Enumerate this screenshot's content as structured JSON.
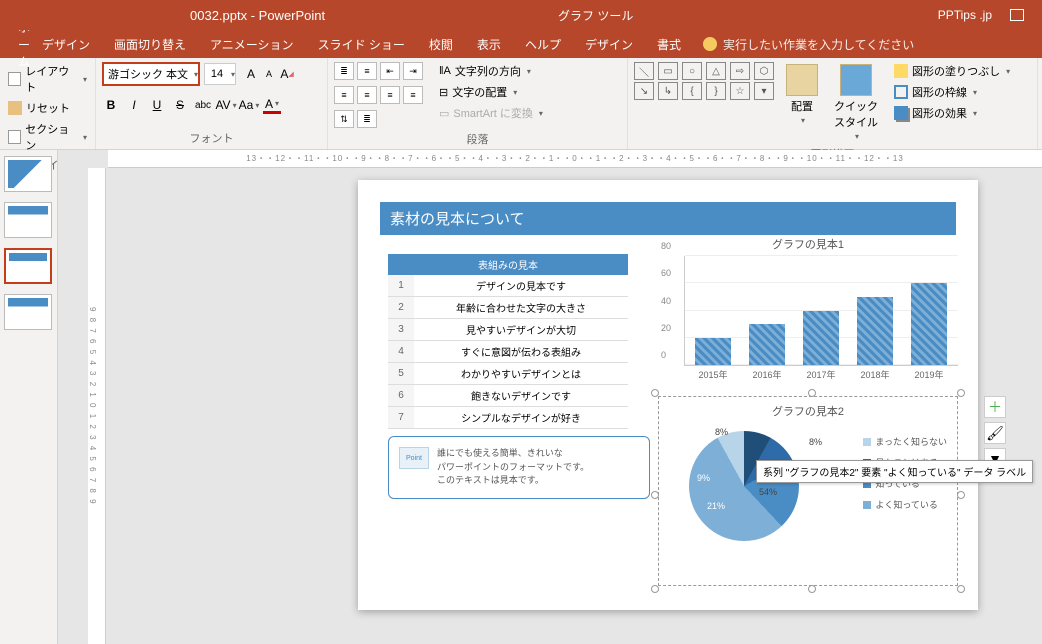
{
  "title": {
    "filename": "0032.pptx - PowerPoint",
    "context": "グラフ ツール",
    "brand": "PPTips .jp"
  },
  "tabs": [
    "ホーム",
    "デザイン",
    "画面切り替え",
    "アニメーション",
    "スライド ショー",
    "校閲",
    "表示",
    "ヘルプ",
    "デザイン",
    "書式"
  ],
  "tellme": "実行したい作業を入力してください",
  "ribbon": {
    "slides": {
      "layout": "レイアウト",
      "reset": "リセット",
      "section": "セクション",
      "label": "スライド"
    },
    "font": {
      "name": "游ゴシック 本文",
      "size": "14",
      "label": "フォント"
    },
    "para": {
      "label": "段落",
      "direction": "文字列の方向",
      "align": "文字の配置",
      "smartart": "SmartArt に変換"
    },
    "draw": {
      "label": "図形描画",
      "arrange": "配置",
      "quick": "クイック\nスタイル",
      "fill": "図形の塗りつぶし",
      "outline": "図形の枠線",
      "effects": "図形の効果"
    }
  },
  "ruler": "13・・12・・11・・10・・9・・8・・7・・6・・5・・4・・3・・2・・1・・0・・1・・2・・3・・4・・5・・6・・7・・8・・9・・10・・11・・12・・13",
  "rulerv": "9  8  7  6  5  4  3  2  1  0  1  2  3  4  5  6  7  8  9",
  "slide": {
    "title": "素材の見本について",
    "table": {
      "header": "表組みの見本",
      "rows": [
        [
          "1",
          "デザインの見本です"
        ],
        [
          "2",
          "年齢に合わせた文字の大きさ"
        ],
        [
          "3",
          "見やすいデザインが大切"
        ],
        [
          "4",
          "すぐに意図が伝わる表組み"
        ],
        [
          "5",
          "わかりやすいデザインとは"
        ],
        [
          "6",
          "飽きないデザインです"
        ],
        [
          "7",
          "シンプルなデザインが好き"
        ]
      ]
    },
    "note": {
      "badge": "Point",
      "text": "誰にでも使える簡単、きれいな\nパワーポイントのフォーマットです。\nこのテキストは見本です。"
    }
  },
  "chart_data": [
    {
      "type": "bar",
      "title": "グラフの見本1",
      "categories": [
        "2015年",
        "2016年",
        "2017年",
        "2018年",
        "2019年"
      ],
      "values": [
        20,
        30,
        40,
        50,
        60
      ],
      "ylim": [
        0,
        80
      ],
      "yticks": [
        0,
        20,
        40,
        60,
        80
      ]
    },
    {
      "type": "pie",
      "title": "グラフの見本2",
      "labels": [
        "まったく知らない",
        "見たことはある",
        "知っている",
        "よく知っている"
      ],
      "values": [
        8,
        9,
        21,
        54,
        8
      ],
      "shown_labels": [
        "8%",
        "9%",
        "21%",
        "54%",
        "8%"
      ],
      "colors": [
        "#b8d4e8",
        "#2e6ba8",
        "#4a8cc4",
        "#7eafd6",
        "#1f4e79"
      ]
    }
  ],
  "tooltip": "系列 \"グラフの見本2\" 要素 \"よく知っている\" データ ラベル",
  "legend": [
    "まったく知らない",
    "見たことはある",
    "知っている",
    "よく知っている"
  ],
  "legendcolors": [
    "#b8d4e8",
    "#2e6ba8",
    "#4a8cc4",
    "#7eafd6"
  ]
}
